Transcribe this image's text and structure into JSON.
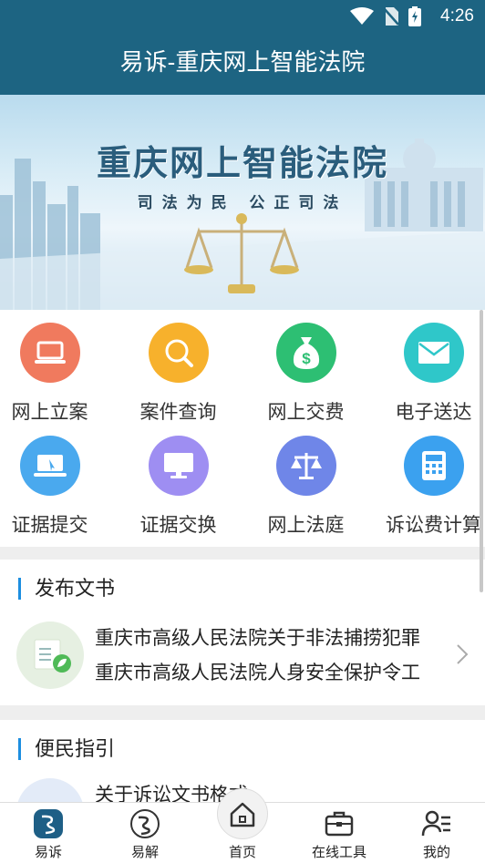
{
  "status_bar": {
    "time": "4:26"
  },
  "header": {
    "title": "易诉-重庆网上智能法院"
  },
  "banner": {
    "title": "重庆网上智能法院",
    "slogan": "司法为民  公正司法"
  },
  "services": [
    {
      "label": "网上立案",
      "icon": "laptop-icon",
      "color": "#f07a5e"
    },
    {
      "label": "案件查询",
      "icon": "search-icon",
      "color": "#f7b12c"
    },
    {
      "label": "网上交费",
      "icon": "money-bag-icon",
      "color": "#2dbf73"
    },
    {
      "label": "电子送达",
      "icon": "envelope-icon",
      "color": "#2fc7c9"
    },
    {
      "label": "证据提交",
      "icon": "laptop-pointer-icon",
      "color": "#4aa9ee"
    },
    {
      "label": "证据交换",
      "icon": "monitor-icon",
      "color": "#9e8ef2"
    },
    {
      "label": "网上法庭",
      "icon": "scales-icon",
      "color": "#6f86e8"
    },
    {
      "label": "诉讼费计算",
      "icon": "calculator-icon",
      "color": "#3ba1ef"
    }
  ],
  "documents": {
    "title": "发布文书",
    "items": [
      "重庆市高级人民法院关于非法捕捞犯罪",
      "重庆市高级人民法院人身安全保护令工"
    ]
  },
  "guide": {
    "title": "便民指引",
    "partial_item": "关于诉讼文书格式"
  },
  "tabs": [
    {
      "label": "易诉",
      "icon": "yisu-logo-icon",
      "active": true
    },
    {
      "label": "易解",
      "icon": "yijie-logo-icon",
      "active": false
    },
    {
      "label": "首页",
      "icon": "home-icon",
      "active": false
    },
    {
      "label": "在线工具",
      "icon": "toolbox-icon",
      "active": false
    },
    {
      "label": "我的",
      "icon": "user-list-icon",
      "active": false
    }
  ],
  "colors": {
    "primary": "#1d6482",
    "accent": "#1c8ee0"
  }
}
